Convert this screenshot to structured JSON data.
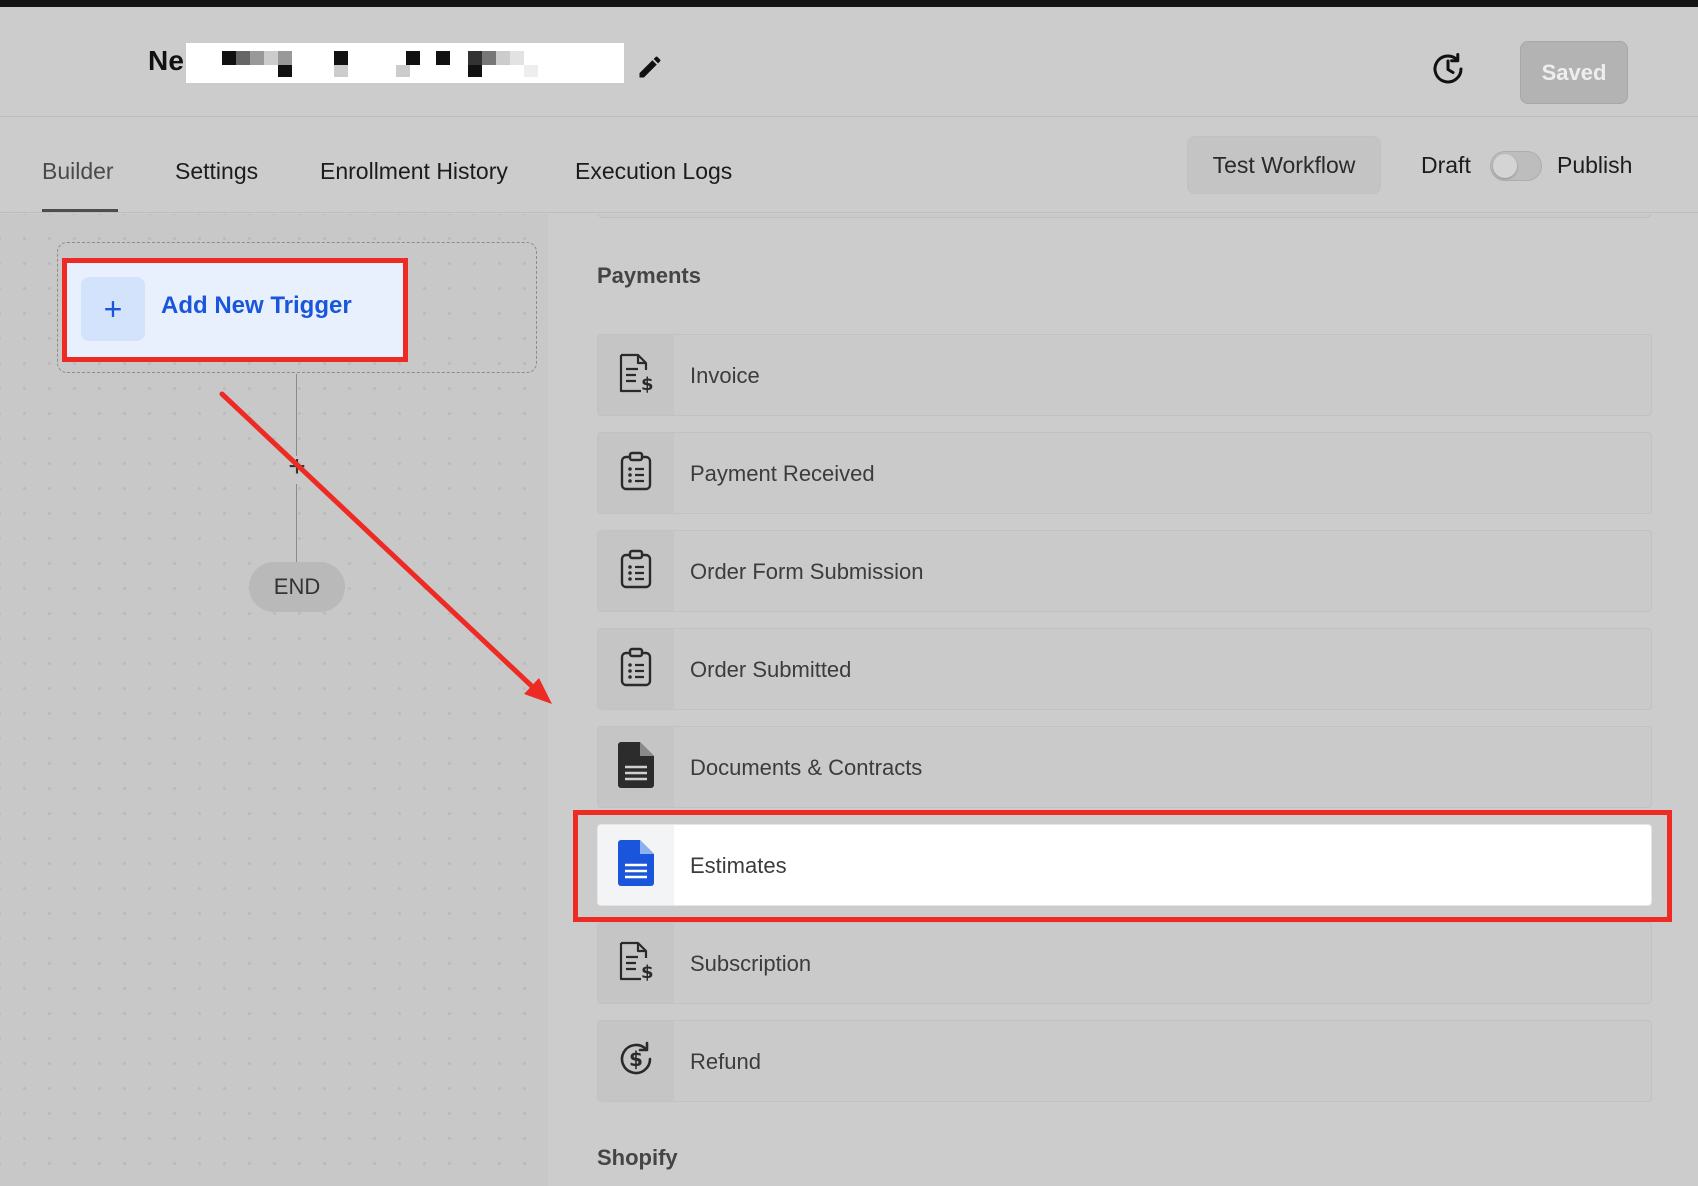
{
  "header": {
    "workflow_title_visible": "Ne",
    "saved_label": "Saved",
    "icons": {
      "edit": "pencil-icon",
      "history": "history-clock-icon"
    }
  },
  "tabs": [
    {
      "label": "Builder",
      "active": true
    },
    {
      "label": "Settings",
      "active": false
    },
    {
      "label": "Enrollment History",
      "active": false
    },
    {
      "label": "Execution Logs",
      "active": false
    }
  ],
  "toolbar": {
    "test_workflow_label": "Test Workflow",
    "draft_label": "Draft",
    "publish_label": "Publish",
    "publish_toggle_on": false
  },
  "canvas": {
    "add_trigger_label": "Add New Trigger",
    "add_trigger_icon": "+",
    "add_step_icon": "+",
    "end_label": "END"
  },
  "panel": {
    "sections": [
      {
        "title": "Payments",
        "items": [
          {
            "label": "Invoice",
            "icon": "invoice-dollar-icon",
            "highlighted": false
          },
          {
            "label": "Payment Received",
            "icon": "clipboard-list-icon",
            "highlighted": false
          },
          {
            "label": "Order Form Submission",
            "icon": "clipboard-list-icon",
            "highlighted": false
          },
          {
            "label": "Order Submitted",
            "icon": "clipboard-list-icon",
            "highlighted": false
          },
          {
            "label": "Documents & Contracts",
            "icon": "document-icon",
            "highlighted": false
          },
          {
            "label": "Estimates",
            "icon": "document-icon",
            "highlighted": true
          },
          {
            "label": "Subscription",
            "icon": "invoice-dollar-icon",
            "highlighted": false
          },
          {
            "label": "Refund",
            "icon": "refund-dollar-icon",
            "highlighted": false
          }
        ]
      },
      {
        "title": "Shopify",
        "items": []
      }
    ]
  },
  "colors": {
    "accent_blue": "#1a56db",
    "annotation_red": "#ee2a24",
    "overlay_gray": "#cccccc"
  }
}
